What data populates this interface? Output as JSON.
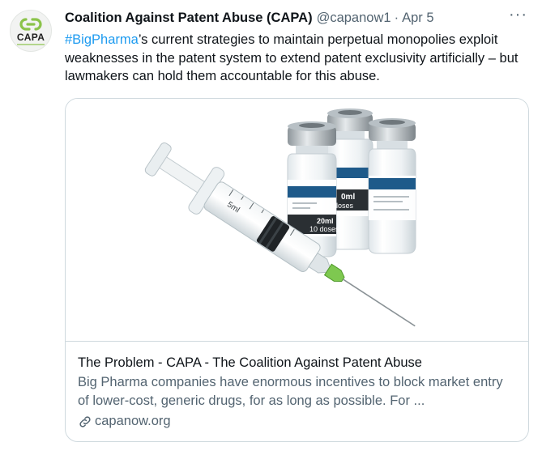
{
  "author": {
    "name": "Coalition Against Patent Abuse (CAPA)",
    "handle": "@capanow1",
    "separator": "·",
    "date": "Apr 5",
    "avatar_text": "CAPA"
  },
  "more_icon": "more-horizontal-icon",
  "more_label": "···",
  "tweet": {
    "hashtag": "#BigPharma",
    "text_rest": "’s current strategies to maintain perpetual monopolies exploit weaknesses in the patent system to extend patent exclusivity artificially – but lawmakers can hold them accountable for this abuse."
  },
  "card": {
    "image_vial_label_front": "20ml",
    "image_vial_label_front_2": "10 doses",
    "image_vial_label_back": "0ml",
    "image_vial_label_back_2": "loses",
    "image_syringe_mark": "5ml",
    "title": "The Problem - CAPA - The Coalition Against Patent Abuse",
    "description": "Big Pharma companies have enormous incentives to block market entry of lower-cost, generic drugs, for as long as possible. For ...",
    "link": "capanow.org",
    "link_icon": "link-icon"
  },
  "colors": {
    "hashtag": "#1d9bf0",
    "secondary_text": "#536471",
    "border": "#cfd9de",
    "logo_green": "#8bc34a"
  }
}
